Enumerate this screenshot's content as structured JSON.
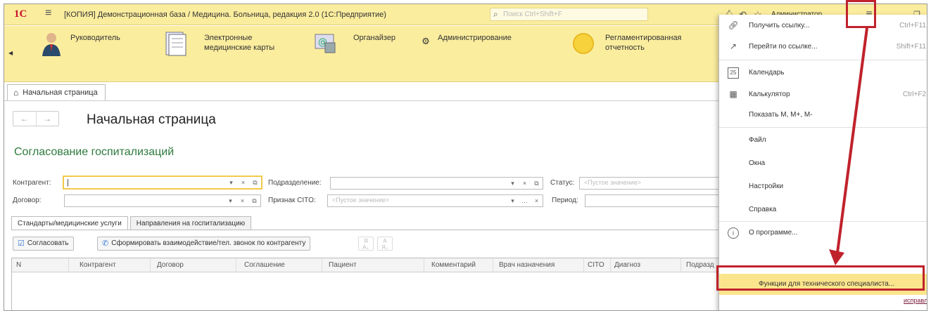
{
  "titlebar": {
    "logo": "1С",
    "title": "[КОПИЯ] Демонстрационная база / Медицина. Больница, редакция 2.0  (1С:Предприятие)",
    "search_placeholder": "Поиск Ctrl+Shift+F",
    "user": "Администратор"
  },
  "sections": [
    {
      "label": "Руководитель",
      "icon": "manager-icon"
    },
    {
      "label": "Электронные медицинские карты",
      "icon": "medical-cards-icon"
    },
    {
      "label": "Органайзер",
      "icon": "organizer-icon"
    },
    {
      "label": "Администрирование",
      "icon": "gear-icon"
    },
    {
      "label": "Регламентированная отчетность",
      "icon": "reports-icon"
    }
  ],
  "tabbar": {
    "home_tab": "Начальная страница"
  },
  "content": {
    "page_title": "Начальная страница",
    "subtitle": "Согласование госпитализаций",
    "filters": {
      "contragent_label": "Контрагент:",
      "division_label": "Подразделение:",
      "status_label": "Статус:",
      "status_placeholder": "<Пустое значение>",
      "contract_label": "Договор:",
      "cito_label": "Признак CITO:",
      "cito_placeholder": "<Пустое значение>",
      "period_label": "Период:"
    },
    "subtabs": [
      "Стандарты/медицинские услуги",
      "Направления на госпитализацию"
    ],
    "buttons": {
      "approve": "Согласовать",
      "form_interaction": "Сформировать взаимодействие/тел. звонок по контрагенту"
    },
    "columns": [
      "N",
      "Контрагент",
      "Договор",
      "Соглашение",
      "Пациент",
      "Комментарий",
      "Врач назначения",
      "CITO",
      "Диагноз",
      "Подразд"
    ]
  },
  "menu": {
    "items": [
      {
        "label": "Получить ссылку...",
        "key": "Ctrl+F11",
        "icon": "link-icon"
      },
      {
        "label": "Перейти по ссылке...",
        "key": "Shift+F11",
        "icon": "goto-link-icon"
      },
      {
        "label": "Календарь",
        "key": "",
        "icon": "calendar-icon"
      },
      {
        "label": "Калькулятор",
        "key": "Ctrl+F2",
        "icon": "calculator-icon"
      },
      {
        "label": "Показать М, М+, М-",
        "key": "",
        "icon": ""
      },
      {
        "label": "Файл",
        "key": "",
        "icon": ""
      },
      {
        "label": "Окна",
        "key": "",
        "icon": ""
      },
      {
        "label": "Настройки",
        "key": "",
        "icon": ""
      },
      {
        "label": "Справка",
        "key": "",
        "icon": ""
      },
      {
        "label": "О программе...",
        "key": "",
        "icon": "info-icon"
      },
      {
        "label": "Функции для технического специалиста...",
        "key": "",
        "icon": ""
      }
    ],
    "calendar_icon_text": "25"
  },
  "side_link": "исправлени",
  "colors": {
    "panel": "#fbed9e",
    "accent_green": "#2d7a3e",
    "annotation_red": "#c0222c",
    "highlight": "#fbe58c"
  }
}
